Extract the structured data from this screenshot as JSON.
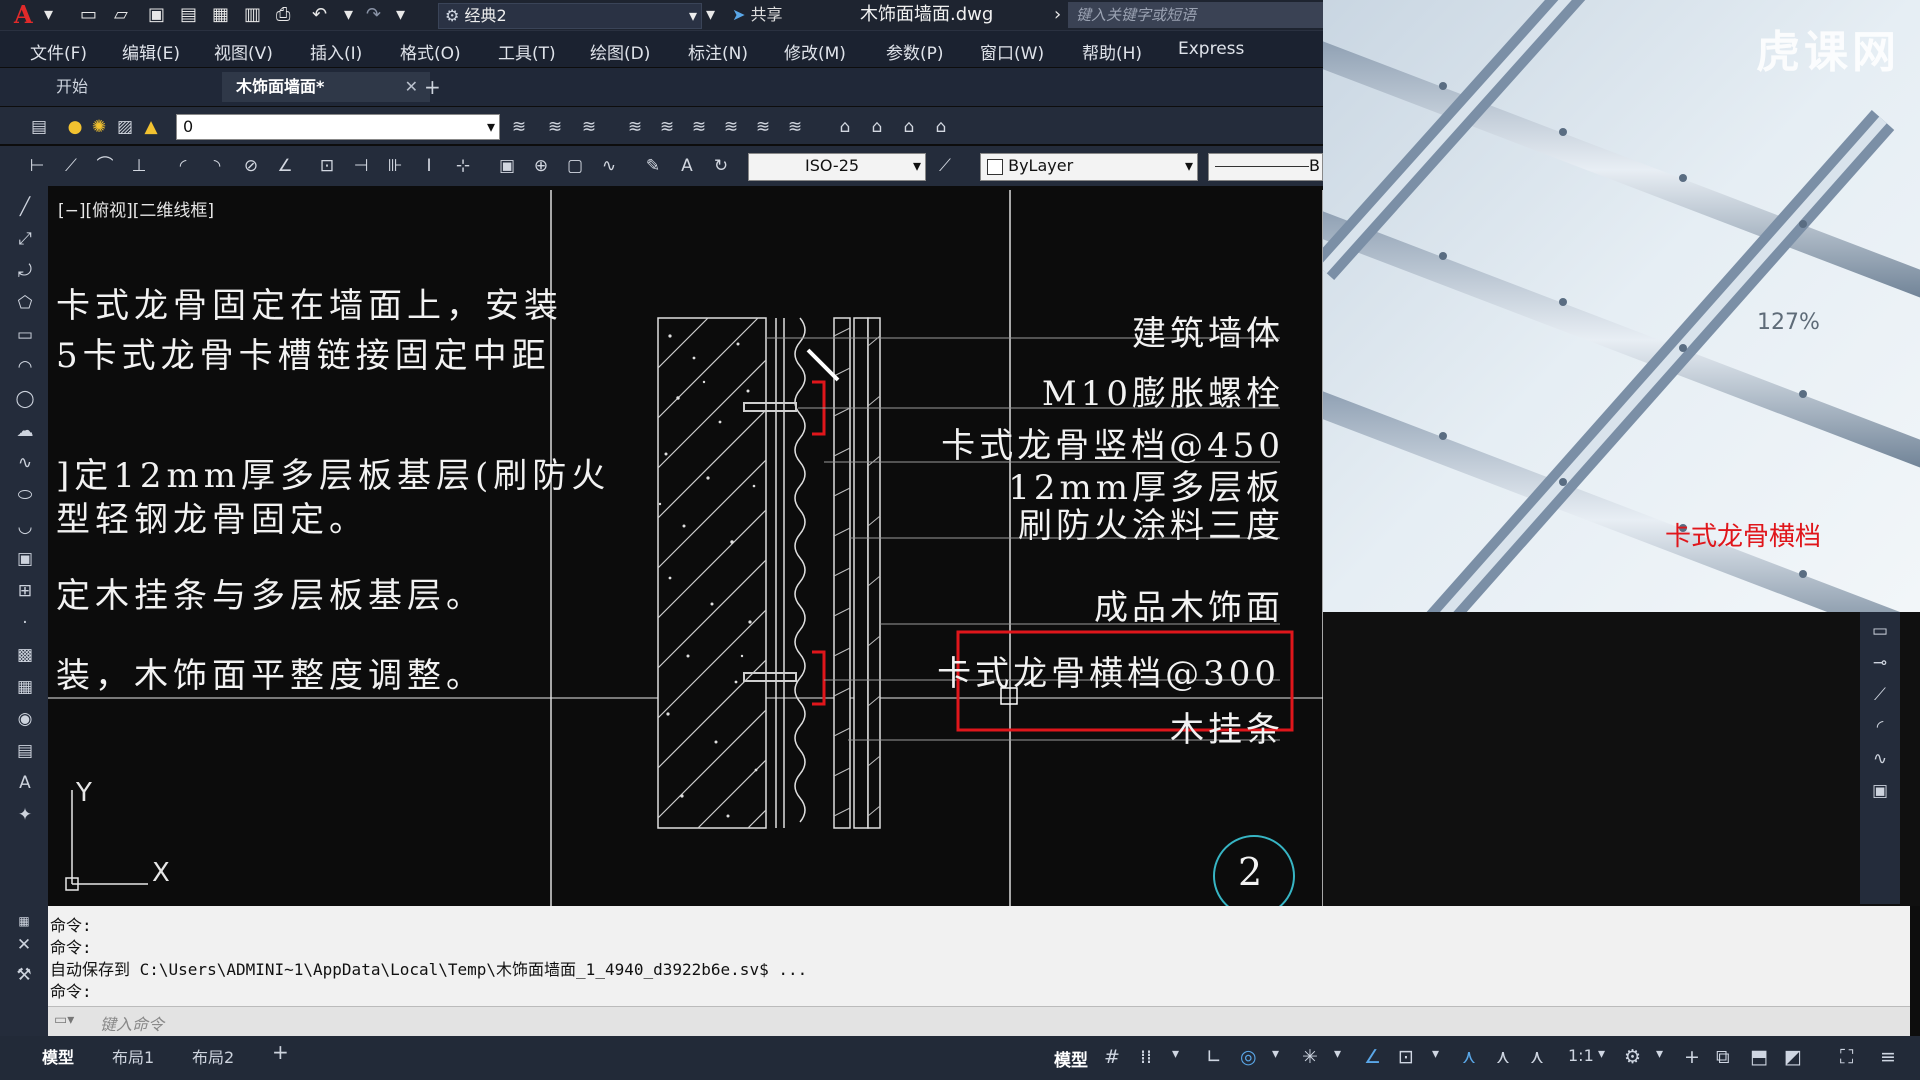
{
  "titlebar": {
    "workspace": "经典2",
    "share_label": "共享",
    "document_title": "木饰面墙面.dwg",
    "search_placeholder": "键入关键字或短语"
  },
  "menus": [
    "文件(F)",
    "编辑(E)",
    "视图(V)",
    "插入(I)",
    "格式(O)",
    "工具(T)",
    "绘图(D)",
    "标注(N)",
    "修改(M)",
    "参数(P)",
    "窗口(W)",
    "帮助(H)",
    "Express"
  ],
  "tabs": {
    "start": "开始",
    "active": "木饰面墙面*"
  },
  "layer_combo": "0",
  "dimstyle_combo": "ISO-25",
  "color_combo": "ByLayer",
  "linetype_combo": "B",
  "viewport_label": "[−][俯视][二维线框]",
  "notes": [
    "卡式龙骨固定在墙面上，安装",
    "5卡式龙骨卡槽链接固定中距",
    "]定12mm厚多层板基层(刷防火",
    "型轻钢龙骨固定。",
    "定木挂条与多层板基层。",
    "装，木饰面平整度调整。"
  ],
  "callouts": [
    "建筑墙体",
    "M10膨胀螺栓",
    "卡式龙骨竖档@450",
    "12mm厚多层板",
    "刷防火涂料三度",
    "成品木饰面",
    "卡式龙骨横档@300",
    "木挂条"
  ],
  "detail_number": "2",
  "ucs": {
    "x": "X",
    "y": "Y"
  },
  "photo": {
    "caption": "卡式龙骨横档",
    "zoom": "127%",
    "watermark": "虎课网"
  },
  "command_history": [
    "命令:",
    "命令:",
    "自动保存到 C:\\Users\\ADMINI~1\\AppData\\Local\\Temp\\木饰面墙面_1_4940_d3922b6e.sv$ ...",
    "命令:"
  ],
  "command_placeholder": "键入命令",
  "layout_tabs": [
    "模型",
    "布局1",
    "布局2"
  ],
  "status": {
    "model_label": "模型",
    "scale": "1:1"
  },
  "colors": {
    "highlight_box": "#e0161b",
    "photo_caption": "#e0161b",
    "detail_circle": "#37b5c4"
  }
}
